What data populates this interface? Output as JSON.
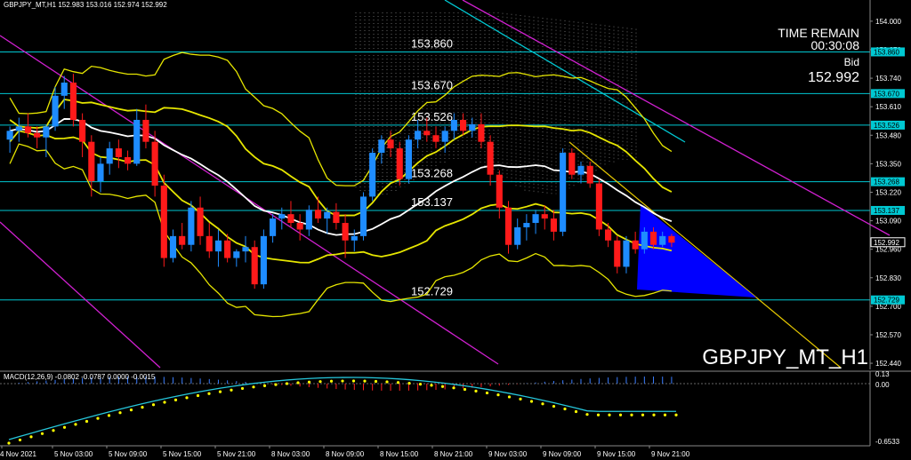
{
  "header": {
    "symbol_line": "GBPJPY_MT,H1  152.983 153.016 152.974 152.992",
    "time_remain_label": "TIME REMAIN",
    "time_remain": "00:30:08",
    "bid_label": "Bid",
    "bid": "152.992",
    "watermark": "GBPJPY_MT_H1"
  },
  "macd_label": "MACD(12,26,9) -0.0802 -0.0787 0.0000 -0.0015",
  "colors": {
    "background": "#000000",
    "bull_candle": "#1e8cff",
    "bear_candle": "#ff1a1a",
    "level_line": "#00c8d2",
    "trend_line": "#d020d0",
    "bollinger": "#e6e600",
    "macd_line": "#26c6da",
    "macd_signal": "#ffff00",
    "macd_hist_pos": "#3a7dff",
    "macd_hist_neg": "#ff2020",
    "blue_triangle": "#0000ff"
  },
  "chart_data": {
    "type": "candlestick",
    "symbol": "GBPJPY_MT",
    "timeframe": "H1",
    "price_axis": {
      "ticks": [
        "154.000",
        "153.870",
        "153.740",
        "153.610",
        "153.480",
        "153.350",
        "153.220",
        "153.090",
        "152.960",
        "152.830",
        "152.700",
        "152.570",
        "152.440"
      ],
      "ylim": [
        152.42,
        154.04
      ]
    },
    "price_tags": [
      "153.860",
      "153.670",
      "153.526",
      "153.268",
      "153.137",
      "152.992",
      "152.729"
    ],
    "level_lines": [
      {
        "label": "153.860",
        "value": 153.86
      },
      {
        "label": "153.670",
        "value": 153.67
      },
      {
        "label": "153.526",
        "value": 153.526
      },
      {
        "label": "153.268",
        "value": 153.268
      },
      {
        "label": "153.137",
        "value": 153.137
      },
      {
        "label": "152.729",
        "value": 152.729
      }
    ],
    "time_axis": [
      "4 Nov 2021",
      "5 Nov 03:00",
      "5 Nov 09:00",
      "5 Nov 15:00",
      "5 Nov 21:00",
      "8 Nov 03:00",
      "8 Nov 09:00",
      "8 Nov 15:00",
      "8 Nov 21:00",
      "9 Nov 03:00",
      "9 Nov 09:00",
      "9 Nov 15:00",
      "9 Nov 21:00"
    ],
    "candles": [
      [
        153.46,
        153.52,
        153.4,
        153.5
      ],
      [
        153.5,
        153.56,
        153.45,
        153.52
      ],
      [
        153.52,
        153.58,
        153.47,
        153.49
      ],
      [
        153.49,
        153.52,
        153.42,
        153.47
      ],
      [
        153.47,
        153.53,
        153.38,
        153.52
      ],
      [
        153.52,
        153.7,
        153.5,
        153.66
      ],
      [
        153.66,
        153.75,
        153.6,
        153.72
      ],
      [
        153.72,
        153.76,
        153.52,
        153.55
      ],
      [
        153.55,
        153.58,
        153.38,
        153.45
      ],
      [
        153.45,
        153.48,
        153.2,
        153.27
      ],
      [
        153.27,
        153.38,
        153.22,
        153.35
      ],
      [
        153.35,
        153.45,
        153.3,
        153.42
      ],
      [
        153.42,
        153.46,
        153.33,
        153.38
      ],
      [
        153.38,
        153.41,
        153.32,
        153.35
      ],
      [
        153.35,
        153.6,
        153.34,
        153.55
      ],
      [
        153.55,
        153.62,
        153.42,
        153.45
      ],
      [
        153.45,
        153.5,
        153.2,
        153.25
      ],
      [
        153.25,
        153.3,
        152.88,
        152.92
      ],
      [
        152.92,
        153.05,
        152.9,
        153.02
      ],
      [
        153.02,
        153.08,
        152.96,
        152.98
      ],
      [
        152.98,
        153.18,
        152.95,
        153.15
      ],
      [
        153.15,
        153.2,
        152.98,
        153.02
      ],
      [
        153.02,
        153.08,
        152.92,
        152.95
      ],
      [
        152.95,
        153.05,
        152.88,
        153.0
      ],
      [
        153.0,
        153.03,
        152.9,
        152.92
      ],
      [
        152.92,
        152.96,
        152.88,
        152.95
      ],
      [
        152.95,
        153.02,
        152.9,
        152.97
      ],
      [
        152.97,
        153.0,
        152.78,
        152.8
      ],
      [
        152.8,
        153.05,
        152.78,
        153.02
      ],
      [
        153.02,
        153.12,
        152.99,
        153.1
      ],
      [
        153.1,
        153.15,
        153.05,
        153.12
      ],
      [
        153.12,
        153.18,
        153.06,
        153.08
      ],
      [
        153.08,
        153.12,
        153.0,
        153.05
      ],
      [
        153.05,
        153.16,
        153.02,
        153.14
      ],
      [
        153.14,
        153.2,
        153.08,
        153.1
      ],
      [
        153.1,
        153.15,
        153.03,
        153.13
      ],
      [
        153.13,
        153.17,
        153.05,
        153.08
      ],
      [
        153.08,
        153.12,
        152.92,
        153.0
      ],
      [
        153.0,
        153.05,
        152.95,
        153.02
      ],
      [
        153.02,
        153.22,
        153.0,
        153.2
      ],
      [
        153.2,
        153.42,
        153.18,
        153.4
      ],
      [
        153.4,
        153.48,
        153.35,
        153.46
      ],
      [
        153.46,
        153.5,
        153.38,
        153.42
      ],
      [
        153.42,
        153.45,
        153.25,
        153.28
      ],
      [
        153.28,
        153.48,
        153.26,
        153.46
      ],
      [
        153.46,
        153.55,
        153.42,
        153.5
      ],
      [
        153.5,
        153.56,
        153.45,
        153.48
      ],
      [
        153.48,
        153.52,
        153.42,
        153.45
      ],
      [
        153.45,
        153.52,
        153.4,
        153.5
      ],
      [
        153.5,
        153.58,
        153.46,
        153.55
      ],
      [
        153.55,
        153.58,
        153.48,
        153.5
      ],
      [
        153.5,
        153.56,
        153.47,
        153.53
      ],
      [
        153.53,
        153.58,
        153.42,
        153.45
      ],
      [
        153.45,
        153.48,
        153.25,
        153.3
      ],
      [
        153.3,
        153.32,
        153.1,
        153.15
      ],
      [
        153.15,
        153.18,
        152.94,
        152.98
      ],
      [
        152.98,
        153.1,
        152.96,
        153.06
      ],
      [
        153.06,
        153.12,
        153.0,
        153.08
      ],
      [
        153.08,
        153.14,
        153.03,
        153.12
      ],
      [
        153.12,
        153.16,
        153.05,
        153.1
      ],
      [
        153.1,
        153.14,
        153.0,
        153.04
      ],
      [
        153.04,
        153.42,
        153.02,
        153.4
      ],
      [
        153.4,
        153.42,
        153.28,
        153.3
      ],
      [
        153.3,
        153.36,
        153.26,
        153.34
      ],
      [
        153.34,
        153.36,
        153.24,
        153.26
      ],
      [
        153.26,
        153.28,
        153.02,
        153.05
      ],
      [
        153.05,
        153.08,
        152.97,
        153.0
      ],
      [
        153.0,
        153.02,
        152.85,
        152.88
      ],
      [
        152.88,
        153.02,
        152.85,
        153.0
      ],
      [
        153.0,
        153.04,
        152.94,
        152.96
      ],
      [
        152.96,
        153.06,
        152.94,
        153.04
      ],
      [
        153.04,
        153.06,
        152.96,
        152.98
      ],
      [
        152.98,
        153.04,
        152.97,
        153.02
      ],
      [
        153.02,
        153.03,
        152.97,
        152.99
      ]
    ],
    "macd": {
      "label": "MACD(12,26,9)",
      "values": [
        -0.0802,
        -0.0787,
        0.0,
        -0.0015
      ],
      "axis_ticks": [
        "0.13",
        "0.00",
        "-0.6533"
      ]
    },
    "watermark": "GBPJPY_MT_H1"
  }
}
